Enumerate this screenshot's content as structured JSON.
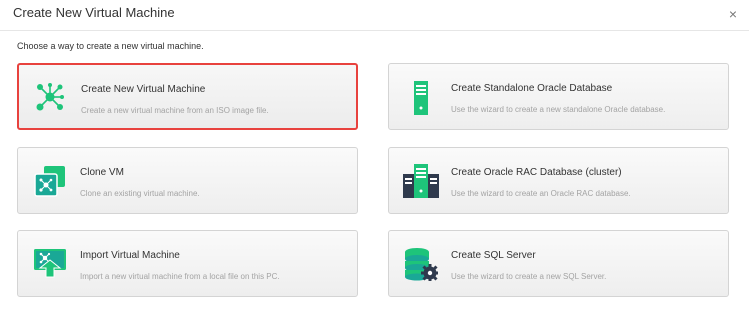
{
  "dialog": {
    "title": "Create New Virtual Machine",
    "close_glyph": "×",
    "instructions": "Choose a way to create a new virtual machine."
  },
  "options": [
    {
      "title": "Create New Virtual Machine",
      "description": "Create a new virtual machine from an ISO image file.",
      "icon": "network-nodes-icon",
      "selected": true
    },
    {
      "title": "Create Standalone Oracle Database",
      "description": "Use the wizard to create a new standalone Oracle database.",
      "icon": "server-tower-icon",
      "selected": false
    },
    {
      "title": "Clone VM",
      "description": "Clone an existing virtual machine.",
      "icon": "clone-vm-icon",
      "selected": false
    },
    {
      "title": "Create Oracle RAC Database (cluster)",
      "description": "Use the wizard to create an Oracle RAC database.",
      "icon": "server-cluster-icon",
      "selected": false
    },
    {
      "title": "Import Virtual Machine",
      "description": "Import a new virtual machine from a local file on this PC.",
      "icon": "import-vm-icon",
      "selected": false
    },
    {
      "title": "Create SQL Server",
      "description": "Use the wizard to create a new SQL Server.",
      "icon": "database-gear-icon",
      "selected": false
    }
  ],
  "colors": {
    "accent_green": "#1ec47a",
    "selection_border": "#e8423e",
    "server_blue": "#2f3a4d"
  }
}
